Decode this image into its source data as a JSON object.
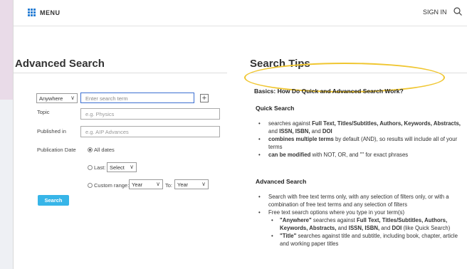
{
  "header": {
    "menu_label": "MENU",
    "signin_label": "SIGN IN",
    "icons": {
      "menu": "grid-icon",
      "search": "search-icon"
    }
  },
  "advanced_search": {
    "title": "Advanced Search",
    "field_select": "Anywhere",
    "term_placeholder": "Enter search term",
    "add_button": "+",
    "topic_label": "Topic",
    "topic_placeholder": "e.g. Physics",
    "published_label": "Published in",
    "published_placeholder": "e.g. AIP Advances",
    "pubdate_label": "Publication Date",
    "all_dates": "All dates",
    "last_label": "Last:",
    "last_select": "Select",
    "custom_label": "Custom range:",
    "from_year": "Year",
    "to_label": "To:",
    "to_year": "Year",
    "search_button": "Search"
  },
  "tips": {
    "title": "Search Tips",
    "basics_heading": "Basics: How Do Quick and Advanced Search Work?",
    "quick_heading": "Quick Search",
    "quick_items": [
      {
        "pre": "searches against ",
        "bold": "Full Text, Titles/Subtitles, Authors, Keywords, Abstracts,",
        "mid": " and ",
        "bold2": "ISSN, ISBN,",
        "mid2": " and ",
        "bold3": "DOI",
        "post": ""
      },
      {
        "bold": "combines multiple terms",
        "post": " by default (AND), so results will include all of your terms"
      },
      {
        "bold": "can be modified",
        "post": " with NOT, OR, and \"\" for exact phrases"
      }
    ],
    "advanced_heading": "Advanced Search",
    "adv_item1": "Search with free text terms only, with any selection of filters only, or with a combination of free text terms and any selection of filters",
    "adv_item2": "Free text search options where you type in your term(s)",
    "sub1_a": "\"Anywhere\"",
    "sub1_b": " searches against ",
    "sub1_c": "Full Text, Titles/Subtitles, Authors, Keywords, Abstracts,",
    "sub1_d": " and ",
    "sub1_e": "ISSN, ISBN,",
    "sub1_f": " and ",
    "sub1_g": "DOI",
    "sub1_h": " (like Quick Search)",
    "sub2_a": "\"Title\"",
    "sub2_b": " searches against title and subtitle, including book, chapter, article and working paper titles"
  },
  "colors": {
    "accent": "#2a7fd4",
    "button": "#37b5e8",
    "highlight": "#f0c630"
  }
}
